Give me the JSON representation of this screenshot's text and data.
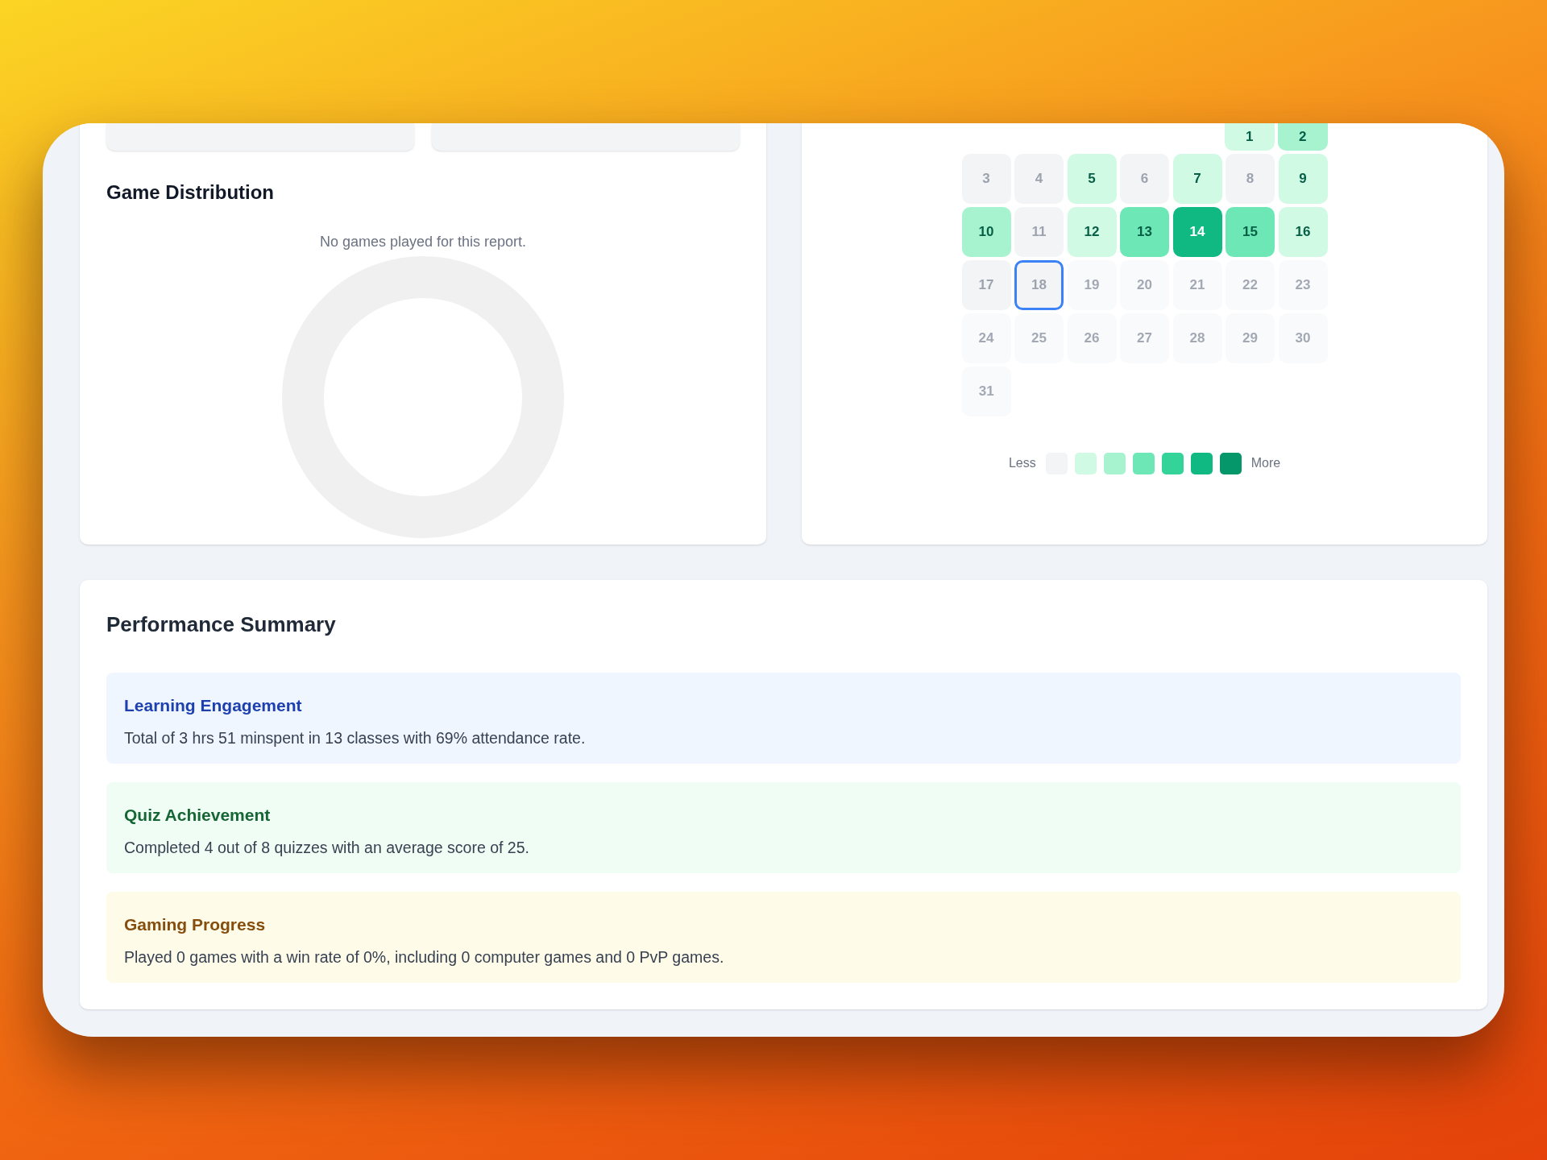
{
  "game_distribution": {
    "title": "Game Distribution",
    "empty_message": "No games played for this report."
  },
  "calendar": {
    "weeks": [
      [
        {
          "day": "1",
          "color": "#d1fae5",
          "selected": false
        },
        {
          "day": "2",
          "color": "#a7f3d0",
          "selected": false
        }
      ],
      [
        {
          "day": "3",
          "color": "#f3f4f6",
          "selected": false
        },
        {
          "day": "4",
          "color": "#f3f4f6",
          "selected": false
        },
        {
          "day": "5",
          "color": "#d1fae5",
          "selected": false
        },
        {
          "day": "6",
          "color": "#f3f4f6",
          "selected": false
        },
        {
          "day": "7",
          "color": "#d1fae5",
          "selected": false
        },
        {
          "day": "8",
          "color": "#f3f4f6",
          "selected": false
        },
        {
          "day": "9",
          "color": "#d1fae5",
          "selected": false
        }
      ],
      [
        {
          "day": "10",
          "color": "#a7f3d0",
          "selected": false
        },
        {
          "day": "11",
          "color": "#f3f4f6",
          "selected": false
        },
        {
          "day": "12",
          "color": "#d1fae5",
          "selected": false
        },
        {
          "day": "13",
          "color": "#6ee7b7",
          "selected": false
        },
        {
          "day": "14",
          "color": "#10b981",
          "selected": false
        },
        {
          "day": "15",
          "color": "#6ee7b7",
          "selected": false
        },
        {
          "day": "16",
          "color": "#d1fae5",
          "selected": false
        }
      ],
      [
        {
          "day": "17",
          "color": "#f3f4f6",
          "selected": false
        },
        {
          "day": "18",
          "color": "#f3f4f6",
          "selected": true
        },
        {
          "day": "19",
          "color": "#f9fafb",
          "selected": false
        },
        {
          "day": "20",
          "color": "#f9fafb",
          "selected": false
        },
        {
          "day": "21",
          "color": "#f9fafb",
          "selected": false
        },
        {
          "day": "22",
          "color": "#f9fafb",
          "selected": false
        },
        {
          "day": "23",
          "color": "#f9fafb",
          "selected": false
        }
      ],
      [
        {
          "day": "24",
          "color": "#f9fafb",
          "selected": false
        },
        {
          "day": "25",
          "color": "#f9fafb",
          "selected": false
        },
        {
          "day": "26",
          "color": "#f9fafb",
          "selected": false
        },
        {
          "day": "27",
          "color": "#f9fafb",
          "selected": false
        },
        {
          "day": "28",
          "color": "#f9fafb",
          "selected": false
        },
        {
          "day": "29",
          "color": "#f9fafb",
          "selected": false
        },
        {
          "day": "30",
          "color": "#f9fafb",
          "selected": false
        }
      ],
      [
        {
          "day": "31",
          "color": "#f9fafb",
          "selected": false
        }
      ]
    ],
    "legend": {
      "less": "Less",
      "more": "More",
      "swatches": [
        {
          "color": "#f3f4f6"
        },
        {
          "color": "#d1fae5"
        },
        {
          "color": "#a7f3d0"
        },
        {
          "color": "#6ee7b7"
        },
        {
          "color": "#34d399"
        },
        {
          "color": "#10b981"
        },
        {
          "color": "#059669"
        }
      ]
    }
  },
  "performance_summary": {
    "title": "Performance Summary",
    "items": [
      {
        "kind": "blue",
        "title": "Learning Engagement",
        "text": "Total of 3 hrs 51 minspent in 13 classes with 69% attendance rate."
      },
      {
        "kind": "green",
        "title": "Quiz Achievement",
        "text": "Completed 4 out of 8 quizzes with an average score of 25."
      },
      {
        "kind": "yellow",
        "title": "Gaming Progress",
        "text": "Played 0 games with a win rate of 0%, including 0 computer games and 0 PvP games."
      }
    ]
  }
}
